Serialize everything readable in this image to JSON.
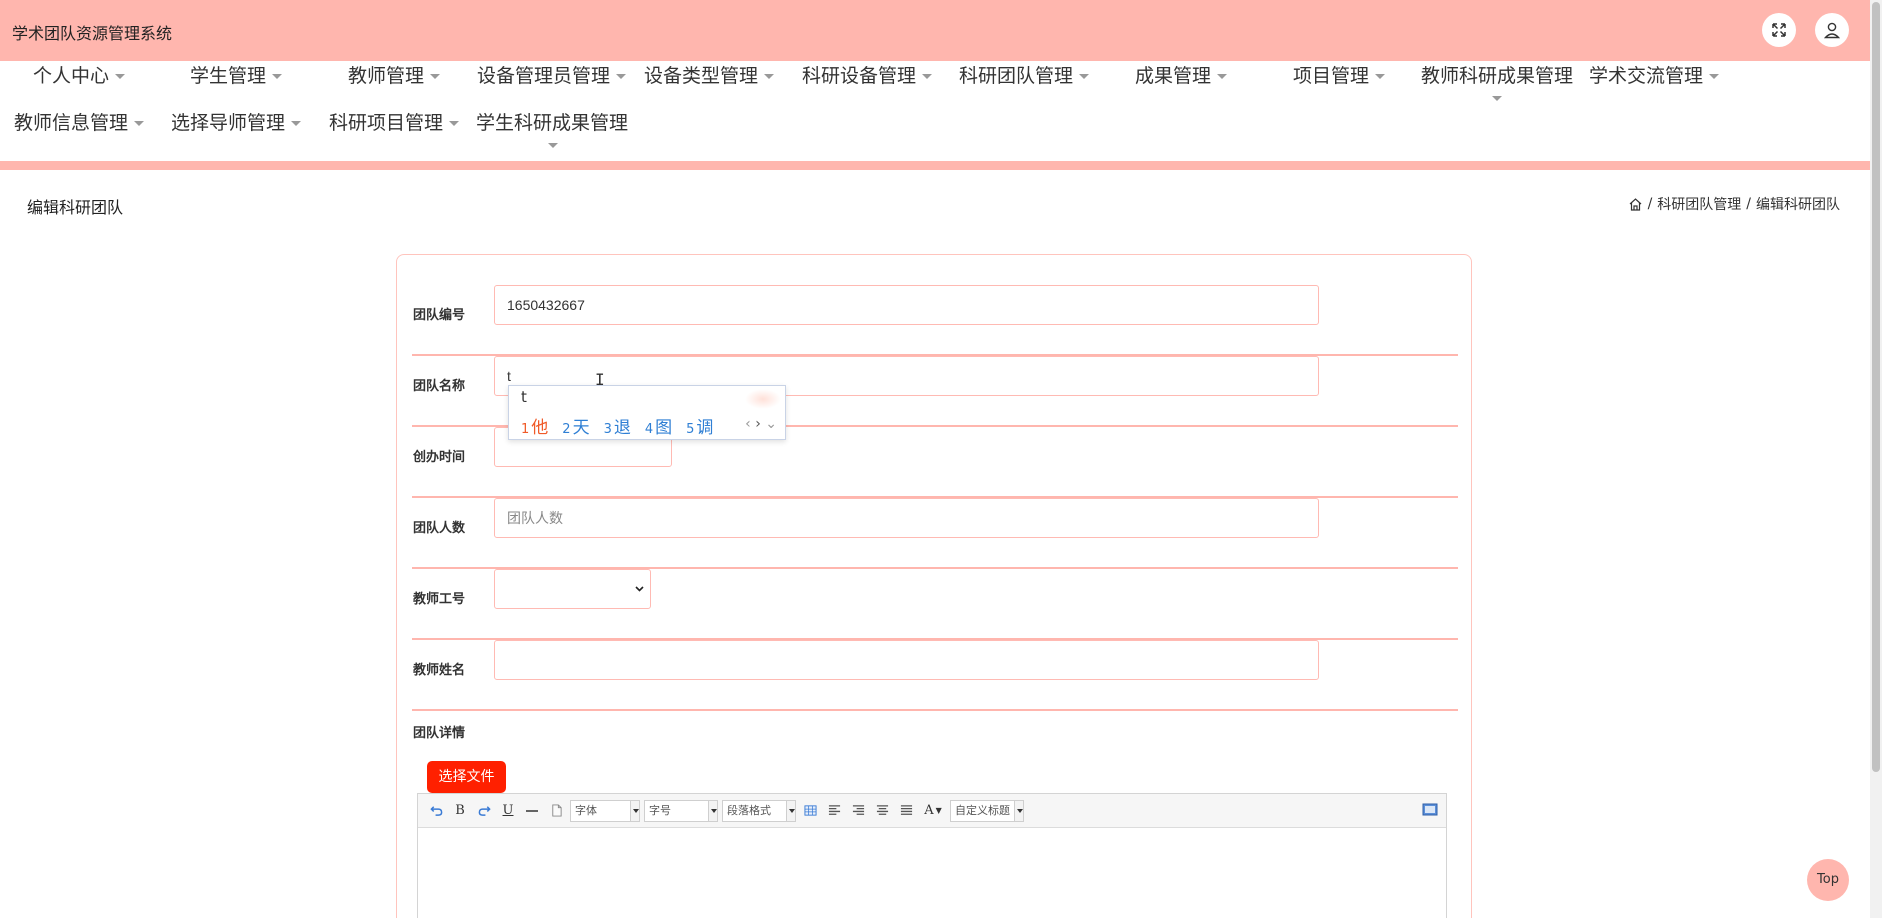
{
  "header": {
    "app_title": "学术团队资源管理系统",
    "fullscreen_icon": "fullscreen-icon",
    "user_icon": "user-icon"
  },
  "nav": {
    "row1": [
      {
        "label": "个人中心"
      },
      {
        "label": "学生管理"
      },
      {
        "label": "教师管理"
      },
      {
        "label": "设备管理员管理"
      },
      {
        "label": "设备类型管理"
      },
      {
        "label": "科研设备管理"
      },
      {
        "label": "科研团队管理"
      },
      {
        "label": "成果管理"
      },
      {
        "label": "项目管理"
      },
      {
        "label": "教师科研成果管理"
      },
      {
        "label": "学术交流管理"
      }
    ],
    "row2": [
      {
        "label": "教师信息管理"
      },
      {
        "label": "选择导师管理"
      },
      {
        "label": "科研项目管理"
      },
      {
        "label": "学生科研成果管理"
      }
    ]
  },
  "page": {
    "title": "编辑科研团队",
    "breadcrumb": [
      "科研团队管理",
      "编辑科研团队"
    ],
    "separator": "/"
  },
  "form": {
    "team_no": {
      "label": "团队编号",
      "value": "1650432667"
    },
    "team_name": {
      "label": "团队名称",
      "value": "t"
    },
    "founded": {
      "label": "创办时间",
      "value": ""
    },
    "team_size": {
      "label": "团队人数",
      "placeholder": "团队人数"
    },
    "teacher_id": {
      "label": "教师工号",
      "value": ""
    },
    "teacher_name": {
      "label": "教师姓名",
      "value": ""
    },
    "detail": {
      "label": "团队详情"
    },
    "file_button": "选择文件"
  },
  "ime": {
    "composition": "t",
    "candidates": [
      {
        "n": "1",
        "text": "他"
      },
      {
        "n": "2",
        "text": "天"
      },
      {
        "n": "3",
        "text": "退"
      },
      {
        "n": "4",
        "text": "图"
      },
      {
        "n": "5",
        "text": "调"
      }
    ]
  },
  "editor": {
    "font_combo": "字体",
    "size_combo": "字号",
    "paragraph_combo": "段落格式",
    "custom_title_combo": "自定义标题",
    "bold": "B",
    "underline": "U",
    "font_color": "A"
  },
  "scroll_top": "Top",
  "colors": {
    "accent": "#ffb6ae",
    "button_red": "#ff2000",
    "ime_first": "#f05a28",
    "ime_candidate": "#2f7fd4"
  }
}
